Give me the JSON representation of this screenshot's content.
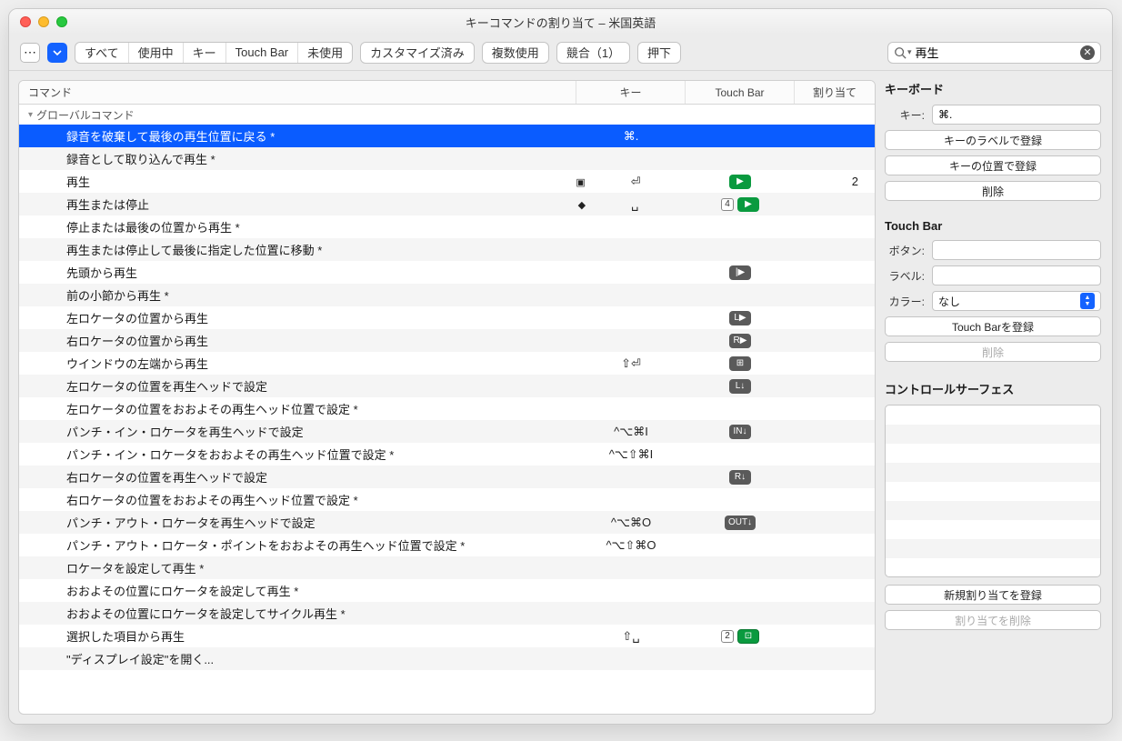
{
  "window": {
    "title": "キーコマンドの割り当て – 米国英語"
  },
  "toolbar": {
    "filters": [
      "すべて",
      "使用中",
      "キー",
      "Touch Bar",
      "未使用"
    ],
    "btn_customized": "カスタマイズ済み",
    "btn_multiple": "複数使用",
    "btn_conflict": "競合（1）",
    "btn_pressed": "押下"
  },
  "search": {
    "placeholder": "",
    "value": "再生"
  },
  "columns": {
    "cmd": "コマンド",
    "key": "キー",
    "tb": "Touch Bar",
    "asgn": "割り当て"
  },
  "group": {
    "label": "グローバルコマンド"
  },
  "rows": [
    {
      "cmd": "録音を破棄して最後の再生位置に戻る *",
      "key": "⌘.",
      "tb": [],
      "asgn": "",
      "selected": true
    },
    {
      "cmd": "録音として取り込んで再生 *",
      "key": "",
      "tb": [],
      "asgn": ""
    },
    {
      "cmd": "再生",
      "key": "⏎",
      "extra_icon": "▣",
      "tb": [
        {
          "t": "green",
          "g": "▶"
        }
      ],
      "asgn": "2"
    },
    {
      "cmd": "再生または停止",
      "key": "␣",
      "extra_icon": "◆",
      "tb": [
        {
          "t": "num",
          "g": "4"
        },
        {
          "t": "green",
          "g": "▶"
        }
      ],
      "asgn": ""
    },
    {
      "cmd": "停止または最後の位置から再生 *",
      "key": "",
      "tb": [],
      "asgn": ""
    },
    {
      "cmd": "再生または停止して最後に指定した位置に移動 *",
      "key": "",
      "tb": [],
      "asgn": ""
    },
    {
      "cmd": "先頭から再生",
      "key": "",
      "tb": [
        {
          "t": "dark",
          "g": "|▶"
        }
      ],
      "asgn": ""
    },
    {
      "cmd": "前の小節から再生 *",
      "key": "",
      "tb": [],
      "asgn": ""
    },
    {
      "cmd": "左ロケータの位置から再生",
      "key": "",
      "tb": [
        {
          "t": "dark",
          "g": "L▶"
        }
      ],
      "asgn": ""
    },
    {
      "cmd": "右ロケータの位置から再生",
      "key": "",
      "tb": [
        {
          "t": "dark",
          "g": "R▶"
        }
      ],
      "asgn": ""
    },
    {
      "cmd": "ウインドウの左端から再生",
      "key": "⇧⏎",
      "tb": [
        {
          "t": "dark",
          "g": "⊞"
        }
      ],
      "asgn": ""
    },
    {
      "cmd": "左ロケータの位置を再生ヘッドで設定",
      "key": "",
      "tb": [
        {
          "t": "dark",
          "g": "L↓"
        }
      ],
      "asgn": ""
    },
    {
      "cmd": "左ロケータの位置をおおよその再生ヘッド位置で設定 *",
      "key": "",
      "tb": [],
      "asgn": ""
    },
    {
      "cmd": "パンチ・イン・ロケータを再生ヘッドで設定",
      "key": "^⌥⌘I",
      "tb": [
        {
          "t": "dark",
          "g": "IN↓"
        }
      ],
      "asgn": ""
    },
    {
      "cmd": "パンチ・イン・ロケータをおおよその再生ヘッド位置で設定 *",
      "key": "^⌥⇧⌘I",
      "tb": [],
      "asgn": ""
    },
    {
      "cmd": "右ロケータの位置を再生ヘッドで設定",
      "key": "",
      "tb": [
        {
          "t": "dark",
          "g": "R↓"
        }
      ],
      "asgn": ""
    },
    {
      "cmd": "右ロケータの位置をおおよその再生ヘッド位置で設定 *",
      "key": "",
      "tb": [],
      "asgn": ""
    },
    {
      "cmd": "パンチ・アウト・ロケータを再生ヘッドで設定",
      "key": "^⌥⌘O",
      "tb": [
        {
          "t": "dark",
          "g": "OUT↓"
        }
      ],
      "asgn": ""
    },
    {
      "cmd": "パンチ・アウト・ロケータ・ポイントをおおよその再生ヘッド位置で設定 *",
      "key": "^⌥⇧⌘O",
      "tb": [],
      "asgn": ""
    },
    {
      "cmd": "ロケータを設定して再生 *",
      "key": "",
      "tb": [],
      "asgn": ""
    },
    {
      "cmd": "おおよその位置にロケータを設定して再生 *",
      "key": "",
      "tb": [],
      "asgn": ""
    },
    {
      "cmd": "おおよその位置にロケータを設定してサイクル再生 *",
      "key": "",
      "tb": [],
      "asgn": ""
    },
    {
      "cmd": "選択した項目から再生",
      "key": "⇧␣",
      "tb": [
        {
          "t": "num",
          "g": "2"
        },
        {
          "t": "green2",
          "g": "⊡"
        }
      ],
      "asgn": ""
    },
    {
      "cmd": "\"ディスプレイ設定\"を開く...",
      "key": "",
      "tb": [],
      "asgn": ""
    }
  ],
  "inspector": {
    "keyboard": {
      "title": "キーボード",
      "key_label": "キー:",
      "key_value": "⌘.",
      "btn_learn_label": "キーのラベルで登録",
      "btn_learn_pos": "キーの位置で登録",
      "btn_delete": "削除"
    },
    "touchbar": {
      "title": "Touch Bar",
      "button_label": "ボタン:",
      "label_label": "ラベル:",
      "color_label": "カラー:",
      "color_value": "なし",
      "btn_learn": "Touch Barを登録",
      "btn_delete": "削除"
    },
    "surface": {
      "title": "コントロールサーフェス",
      "btn_learn": "新規割り当てを登録",
      "btn_delete": "割り当てを削除"
    }
  }
}
